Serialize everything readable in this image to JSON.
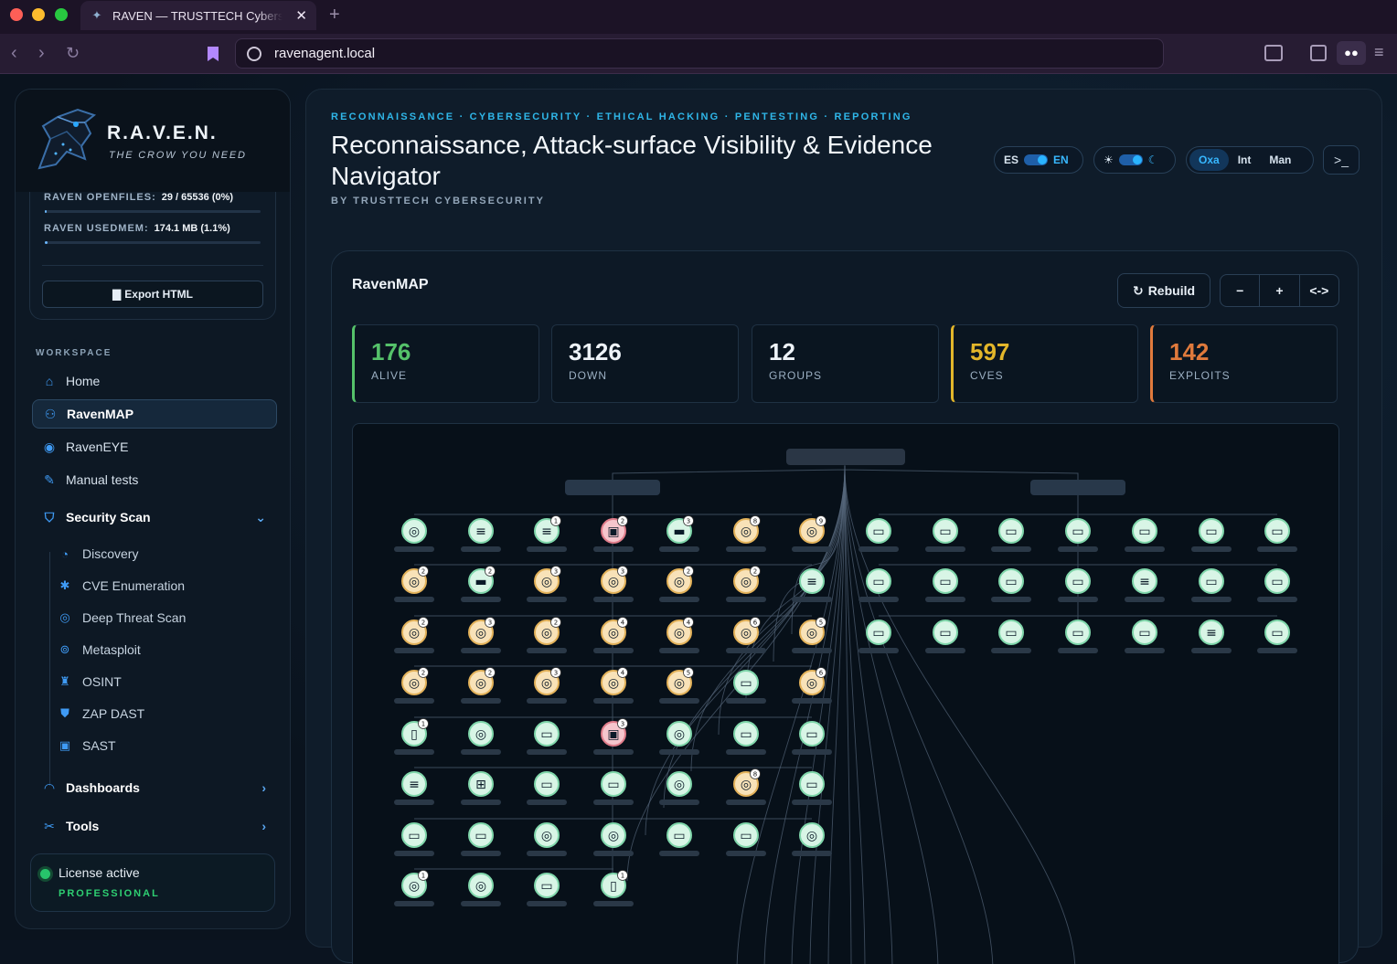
{
  "browser": {
    "tab_title": "RAVEN — TRUSTTECH Cybersecurity",
    "tab_close": "✕",
    "new_tab": "+",
    "url": "ravenagent.local"
  },
  "brand": {
    "title": "R.A.V.E.N.",
    "tagline": "THE CROW YOU NEED"
  },
  "metrics": {
    "openfiles_label": "RAVEN OPENFILES:",
    "openfiles_value": "29 / 65536 (0%)",
    "openfiles_fraction": 0.0004,
    "usedmem_label": "RAVEN USEDMEM:",
    "usedmem_value": "174.1 MB (1.1%)",
    "usedmem_fraction": 0.011,
    "export_label": "Export HTML"
  },
  "sidebar": {
    "section_label": "WORKSPACE",
    "items": [
      {
        "label": "Home",
        "icon": "home-icon"
      },
      {
        "label": "RavenMAP",
        "icon": "network-icon",
        "active": true
      },
      {
        "label": "RavenEYE",
        "icon": "eye-icon"
      },
      {
        "label": "Manual tests",
        "icon": "edit-icon"
      }
    ],
    "security_scan": {
      "label": "Security Scan",
      "icon": "shield-icon",
      "children": [
        {
          "label": "Discovery",
          "icon": "radar-icon"
        },
        {
          "label": "CVE Enumeration",
          "icon": "bug-icon"
        },
        {
          "label": "Deep Threat Scan",
          "icon": "target-icon"
        },
        {
          "label": "Metasploit",
          "icon": "crosshair-icon"
        },
        {
          "label": "OSINT",
          "icon": "binoculars-icon"
        },
        {
          "label": "ZAP DAST",
          "icon": "shield-half-icon"
        },
        {
          "label": "SAST",
          "icon": "code-file-icon"
        }
      ]
    },
    "dashboards": {
      "label": "Dashboards",
      "icon": "gauge-icon"
    },
    "tools": {
      "label": "Tools",
      "icon": "wrench-icon"
    },
    "license": {
      "text": "License active",
      "tier": "PROFESSIONAL"
    }
  },
  "header": {
    "kicker": "RECONNAISSANCE · CYBERSECURITY · ETHICAL HACKING · PENTESTING · REPORTING",
    "title": "Reconnaissance, Attack-surface Visibility & Evidence Navigator",
    "byline": "BY TRUSTTECH CYBERSECURITY",
    "lang": {
      "left": "ES",
      "right": "EN"
    },
    "modes": [
      "Oxa",
      "Int",
      "Man"
    ],
    "terminal": ">_"
  },
  "map": {
    "title": "RavenMAP",
    "rebuild_label": "Rebuild",
    "zoom_out": "−",
    "zoom_in": "+",
    "fit": "<->",
    "stats": [
      {
        "value": "176",
        "label": "ALIVE",
        "color": "#55c26a"
      },
      {
        "value": "3126",
        "label": "DOWN",
        "color": "#eef3f8"
      },
      {
        "value": "12",
        "label": "GROUPS",
        "color": "#eef3f8"
      },
      {
        "value": "597",
        "label": "CVES",
        "color": "#e3b62a"
      },
      {
        "value": "142",
        "label": "EXPLOITS",
        "color": "#e07a3c"
      }
    ],
    "left_grid": [
      [
        "globe",
        "wave",
        "wave",
        "server-red",
        "folder",
        "globe",
        "globe"
      ],
      [
        "globe",
        "folder",
        "globe",
        "globe",
        "globe",
        "globe",
        "wave"
      ],
      [
        "globe",
        "globe",
        "globe",
        "globe",
        "globe",
        "globe",
        "globe"
      ],
      [
        "globe",
        "globe",
        "globe",
        "globe",
        "globe",
        "monitor",
        "globe"
      ],
      [
        "mobile",
        "globe",
        "monitor",
        "server-red",
        "globe",
        "monitor",
        "monitor"
      ],
      [
        "wave",
        "windows",
        "monitor",
        "monitor",
        "globe",
        "globe",
        "monitor"
      ],
      [
        "monitor",
        "monitor",
        "globe",
        "globe",
        "monitor",
        "monitor",
        "globe"
      ],
      [
        "globe",
        "globe",
        "monitor",
        "mobile"
      ]
    ],
    "left_badges": [
      [
        "",
        "",
        "1",
        "2",
        "3",
        "8",
        "9"
      ],
      [
        "2",
        "2",
        "3",
        "3",
        "2",
        "2",
        ""
      ],
      [
        "2",
        "3",
        "2",
        "4",
        "4",
        "6",
        "5"
      ],
      [
        "2",
        "2",
        "3",
        "4",
        "5",
        "",
        "6"
      ],
      [
        "1",
        "",
        "",
        "3",
        "",
        "",
        ""
      ],
      [
        "",
        "",
        "",
        "",
        "",
        "8",
        ""
      ],
      [
        "",
        "",
        "",
        "",
        "",
        "",
        ""
      ],
      [
        "1",
        "",
        "",
        "1"
      ]
    ],
    "left_warn": [
      [
        0,
        0,
        0,
        0,
        0,
        1,
        1
      ],
      [
        1,
        0,
        1,
        1,
        1,
        1,
        0
      ],
      [
        1,
        1,
        1,
        1,
        1,
        1,
        1
      ],
      [
        1,
        1,
        1,
        1,
        1,
        0,
        1
      ],
      [
        0,
        0,
        0,
        0,
        0,
        0,
        0
      ],
      [
        0,
        0,
        0,
        0,
        0,
        1,
        0
      ],
      [
        0,
        0,
        0,
        0,
        0,
        0,
        0
      ],
      [
        0,
        0,
        0,
        0
      ]
    ],
    "right_grid": [
      [
        "monitor",
        "monitor",
        "monitor",
        "monitor",
        "monitor",
        "monitor",
        "monitor"
      ],
      [
        "monitor",
        "monitor",
        "monitor",
        "monitor",
        "wave",
        "monitor",
        "monitor"
      ],
      [
        "monitor",
        "monitor",
        "monitor",
        "monitor",
        "monitor",
        "wave",
        "monitor"
      ]
    ]
  }
}
